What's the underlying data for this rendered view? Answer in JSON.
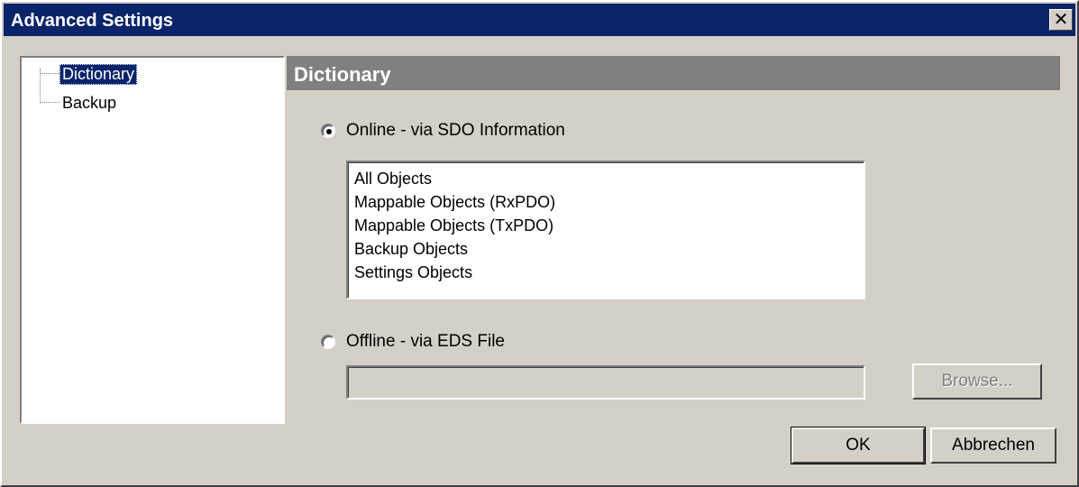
{
  "window": {
    "title": "Advanced Settings",
    "close_glyph": "✕"
  },
  "tree": {
    "items": [
      {
        "label": "Dictionary",
        "selected": true
      },
      {
        "label": "Backup",
        "selected": false
      }
    ]
  },
  "section": {
    "title": "Dictionary"
  },
  "online": {
    "label": "Online - via SDO Information",
    "checked": true,
    "list": [
      "All Objects",
      "Mappable Objects (RxPDO)",
      "Mappable Objects (TxPDO)",
      "Backup Objects",
      "Settings Objects"
    ]
  },
  "offline": {
    "label": "Offline - via EDS File",
    "checked": false,
    "file_value": "",
    "browse_label": "Browse..."
  },
  "buttons": {
    "ok": "OK",
    "cancel": "Abbrechen"
  }
}
